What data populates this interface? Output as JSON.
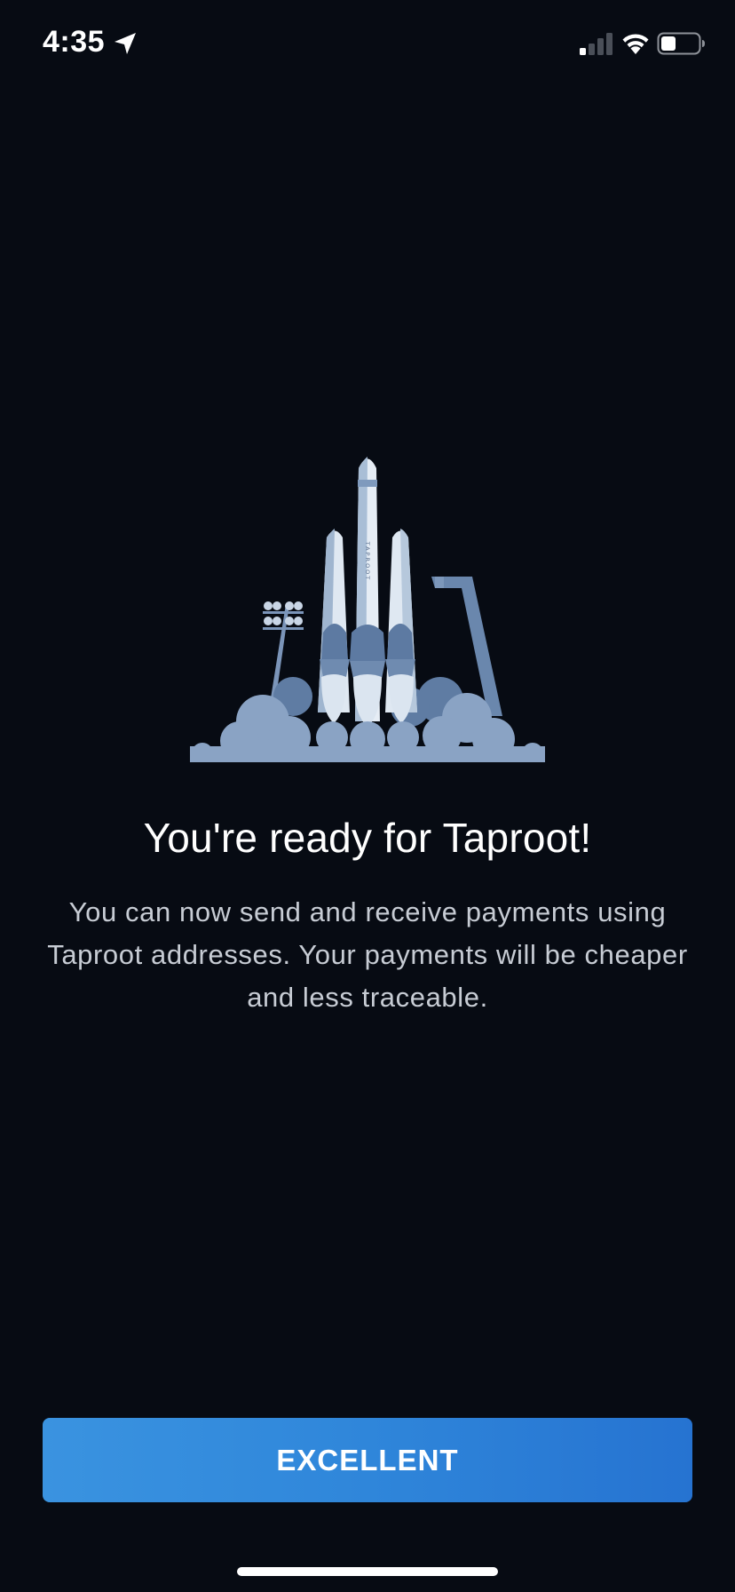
{
  "status_bar": {
    "time": "4:35",
    "icons": [
      "location-arrow-icon",
      "cellular-signal-icon",
      "wifi-icon",
      "battery-icon"
    ]
  },
  "illustration": {
    "name": "rocket-launch-illustration",
    "rocket_text": "TAPROOT"
  },
  "content": {
    "title": "You're ready for Taproot!",
    "body": "You can now send and receive payments using Taproot addresses. Your payments will be cheaper and less traceable."
  },
  "actions": {
    "primary_label": "EXCELLENT"
  },
  "colors": {
    "background": "#070b13",
    "button_gradient_start": "#3a93e0",
    "button_gradient_end": "#2673d1",
    "body_text": "#c7ccd4",
    "cloud": "#8aa3c4"
  }
}
